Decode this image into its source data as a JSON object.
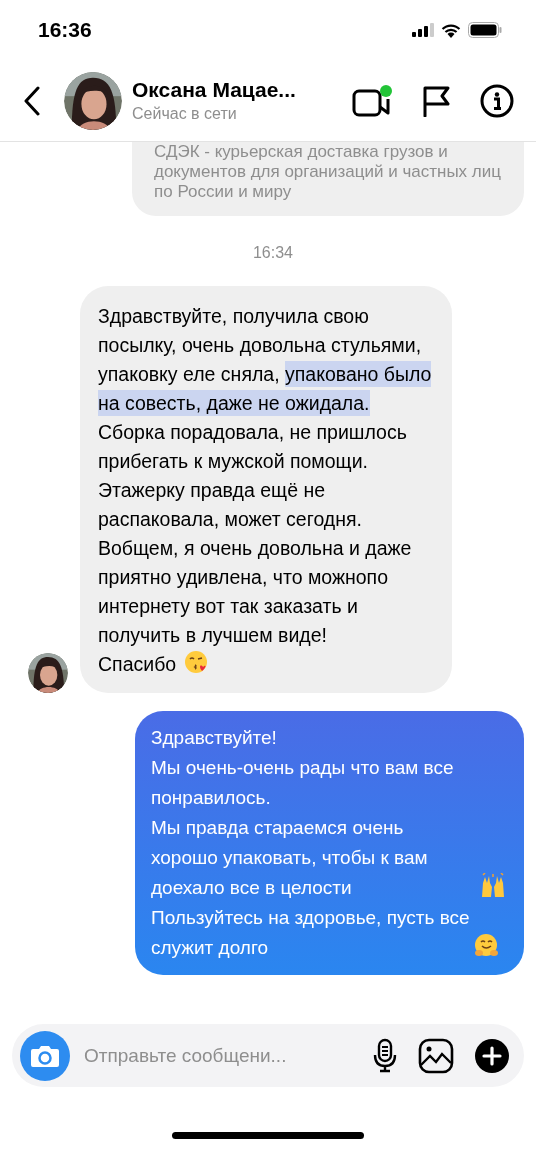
{
  "status_bar": {
    "time": "16:36"
  },
  "header": {
    "name": "Оксана Мацае...",
    "status": "Сейчас в сети",
    "video_online": true
  },
  "messages": [
    {
      "kind": "preview",
      "paragraphs": [
        {
          "kind": "plain",
          "parts": [
            {
              "text": "СДЭК - курьерская доставка грузов и документов для организаций и частных лиц по России и миру",
              "highlighted": false
            }
          ]
        }
      ]
    },
    {
      "kind": "timestamp",
      "text": "16:34"
    },
    {
      "kind": "received",
      "paragraphs": [
        {
          "kind": "plain",
          "parts": [
            {
              "text": "Здравствуйте, получила свою посылку, очень довольна стульями, упаковку еле сняла, ",
              "highlighted": false
            },
            {
              "text": "упаковано было на совесть, даже не ожидала.",
              "highlighted": true
            },
            {
              "text": " Сборка порадовала, не пришлось прибегать к мужской помощи. Этажерку правда ещё не распаковала, может сегодня.",
              "highlighted": false
            }
          ]
        },
        {
          "kind": "plain",
          "parts": [
            {
              "text": "Вобщем, я очень довольна и даже приятно удивлена, что можнопо интернету вот так заказать и получить в лучшем виде!",
              "highlighted": false
            }
          ]
        },
        {
          "kind": "kiss",
          "parts": [
            {
              "text": "Спасибо",
              "highlighted": false
            }
          ]
        }
      ]
    },
    {
      "kind": "sent",
      "paragraphs": [
        {
          "kind": "plain",
          "parts": [
            {
              "text": "Здравствуйте!",
              "highlighted": false
            }
          ]
        },
        {
          "kind": "plain",
          "parts": [
            {
              "text": "Мы очень-очень рады что вам все понравилось.",
              "highlighted": false
            }
          ]
        },
        {
          "kind": "raised_hands",
          "parts": [
            {
              "text": "Мы правда стараемся очень хорошо упаковать, чтобы к вам доехало все в целости",
              "highlighted": false
            }
          ]
        },
        {
          "kind": "hug",
          "parts": [
            {
              "text": "Пользуйтесь на здоровье, пусть все служит долго",
              "highlighted": false
            }
          ]
        }
      ]
    }
  ],
  "composer": {
    "placeholder": "Отправьте сообщени..."
  }
}
